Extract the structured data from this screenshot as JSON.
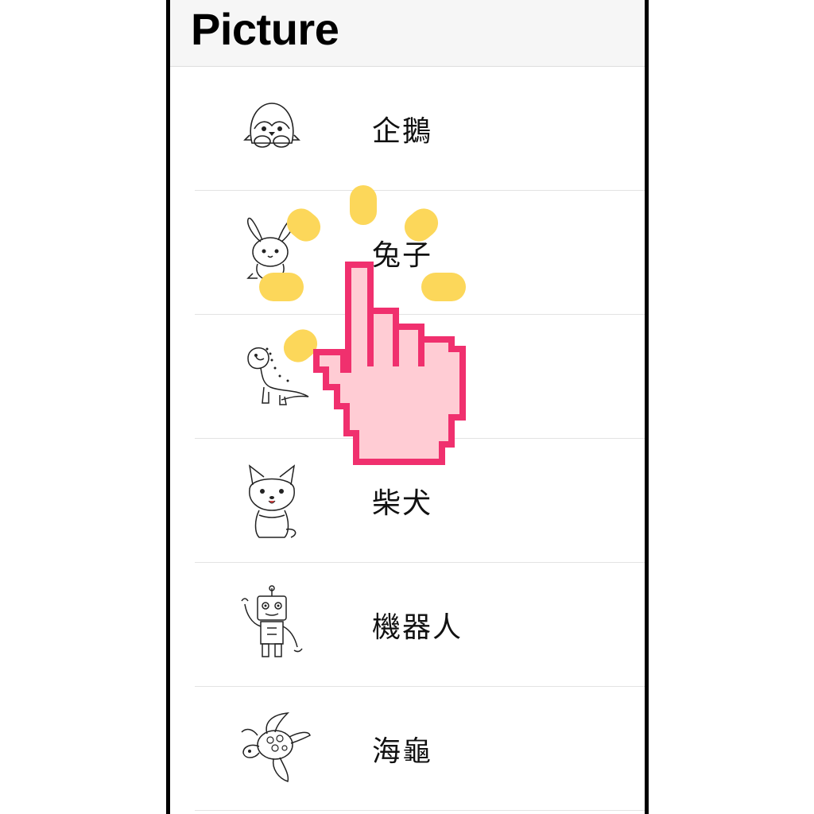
{
  "navbar": {
    "title": "Picture"
  },
  "items": [
    {
      "label": "企鵝",
      "icon": "penguin-icon"
    },
    {
      "label": "兔子",
      "icon": "rabbit-icon"
    },
    {
      "label": "",
      "icon": "dinosaur-icon"
    },
    {
      "label": "柴犬",
      "icon": "shiba-dog-icon"
    },
    {
      "label": "機器人",
      "icon": "robot-icon"
    },
    {
      "label": "海龜",
      "icon": "sea-turtle-icon"
    }
  ],
  "overlay": {
    "icon": "tap-hand-cursor-icon",
    "colors": {
      "hand_fill": "#ffccd4",
      "hand_stroke": "#f0306e",
      "burst": "#fcd75a"
    }
  }
}
